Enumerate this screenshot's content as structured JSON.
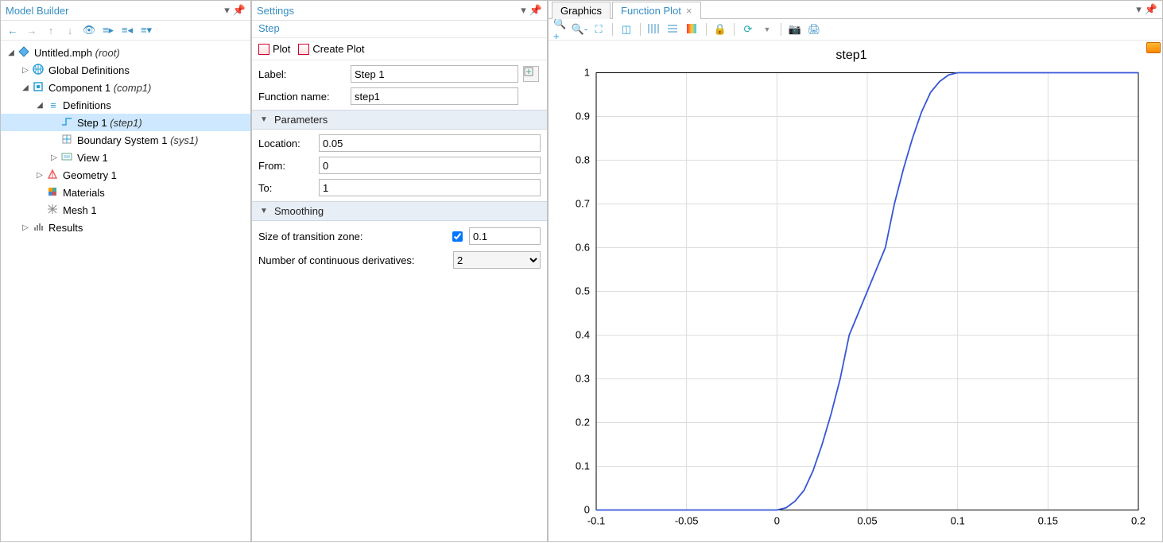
{
  "modelBuilder": {
    "title": "Model Builder",
    "tree": {
      "root": {
        "label": "Untitled.mph",
        "suffix": "(root)"
      },
      "globalDefs": "Global Definitions",
      "component": {
        "label": "Component 1",
        "suffix": "(comp1)"
      },
      "definitions": "Definitions",
      "step": {
        "label": "Step 1",
        "suffix": "(step1)"
      },
      "boundary": {
        "label": "Boundary System 1",
        "suffix": "(sys1)"
      },
      "view": "View 1",
      "geometry": "Geometry 1",
      "materials": "Materials",
      "mesh": "Mesh 1",
      "results": "Results"
    }
  },
  "settings": {
    "title": "Settings",
    "subtitle": "Step",
    "actions": {
      "plot": "Plot",
      "createPlot": "Create Plot"
    },
    "labelField": {
      "label": "Label:",
      "value": "Step 1"
    },
    "funcName": {
      "label": "Function name:",
      "value": "step1"
    },
    "sections": {
      "parameters": {
        "title": "Parameters",
        "location": {
          "label": "Location:",
          "value": "0.05"
        },
        "from": {
          "label": "From:",
          "value": "0"
        },
        "to": {
          "label": "To:",
          "value": "1"
        }
      },
      "smoothing": {
        "title": "Smoothing",
        "transitionZone": {
          "label": "Size of transition zone:",
          "checked": true,
          "value": "0.1"
        },
        "derivatives": {
          "label": "Number of continuous derivatives:",
          "value": "2"
        }
      }
    }
  },
  "graphics": {
    "tabs": {
      "graphics": "Graphics",
      "functionPlot": "Function Plot"
    },
    "activeTab": "functionPlot",
    "plotTitle": "step1"
  },
  "chart_data": {
    "type": "line",
    "title": "step1",
    "xlabel": "",
    "ylabel": "",
    "xlim": [
      -0.1,
      0.2
    ],
    "ylim": [
      0,
      1
    ],
    "xticks": [
      -0.1,
      -0.05,
      0,
      0.05,
      0.1,
      0.15,
      0.2
    ],
    "yticks": [
      0,
      0.1,
      0.2,
      0.3,
      0.4,
      0.5,
      0.6,
      0.7,
      0.8,
      0.9,
      1
    ],
    "series": [
      {
        "name": "step1",
        "x": [
          -0.1,
          -0.02,
          -0.01,
          0.0,
          0.005,
          0.01,
          0.015,
          0.02,
          0.025,
          0.03,
          0.035,
          0.04,
          0.045,
          0.05,
          0.055,
          0.06,
          0.065,
          0.07,
          0.075,
          0.08,
          0.085,
          0.09,
          0.095,
          0.1,
          0.11,
          0.12,
          0.2
        ],
        "y": [
          0.0,
          0.0,
          0.0,
          0.0,
          0.005,
          0.02,
          0.045,
          0.09,
          0.15,
          0.22,
          0.3,
          0.4,
          0.45,
          0.5,
          0.55,
          0.6,
          0.7,
          0.78,
          0.85,
          0.91,
          0.955,
          0.98,
          0.995,
          1.0,
          1.0,
          1.0,
          1.0
        ]
      }
    ]
  }
}
